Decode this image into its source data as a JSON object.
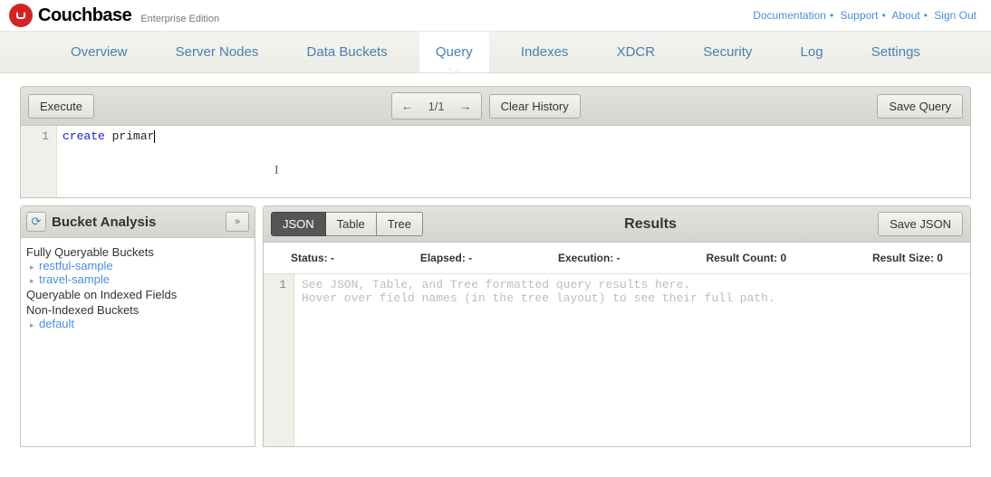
{
  "brand": {
    "name": "Couchbase",
    "edition": "Enterprise Edition"
  },
  "top_links": {
    "documentation": "Documentation",
    "support": "Support",
    "about": "About",
    "sign_out": "Sign Out"
  },
  "nav": {
    "overview": "Overview",
    "server_nodes": "Server Nodes",
    "data_buckets": "Data Buckets",
    "query": "Query",
    "indexes": "Indexes",
    "xdcr": "XDCR",
    "security": "Security",
    "log": "Log",
    "settings": "Settings"
  },
  "toolbar": {
    "execute": "Execute",
    "page_indicator": "1/1",
    "clear_history": "Clear History",
    "save_query": "Save Query"
  },
  "editor": {
    "line_number": "1",
    "keyword": "create",
    "rest": " primar"
  },
  "bucket": {
    "title": "Bucket Analysis",
    "group1": "Fully Queryable Buckets",
    "item1": "restful-sample",
    "item2": "travel-sample",
    "group2": "Queryable on Indexed Fields",
    "group3": "Non-Indexed Buckets",
    "item3": "default"
  },
  "results": {
    "tabs": {
      "json": "JSON",
      "table": "Table",
      "tree": "Tree"
    },
    "title": "Results",
    "save_json": "Save JSON",
    "stats": {
      "status_label": "Status: -",
      "elapsed_label": "Elapsed: -",
      "execution_label": "Execution: -",
      "count_label": "Result Count: 0",
      "size_label": "Result Size: 0"
    },
    "line_number": "1",
    "placeholder_line1": "See JSON, Table, and Tree formatted query results here.",
    "placeholder_line2": "Hover over field names (in the tree layout) to see their full path."
  }
}
